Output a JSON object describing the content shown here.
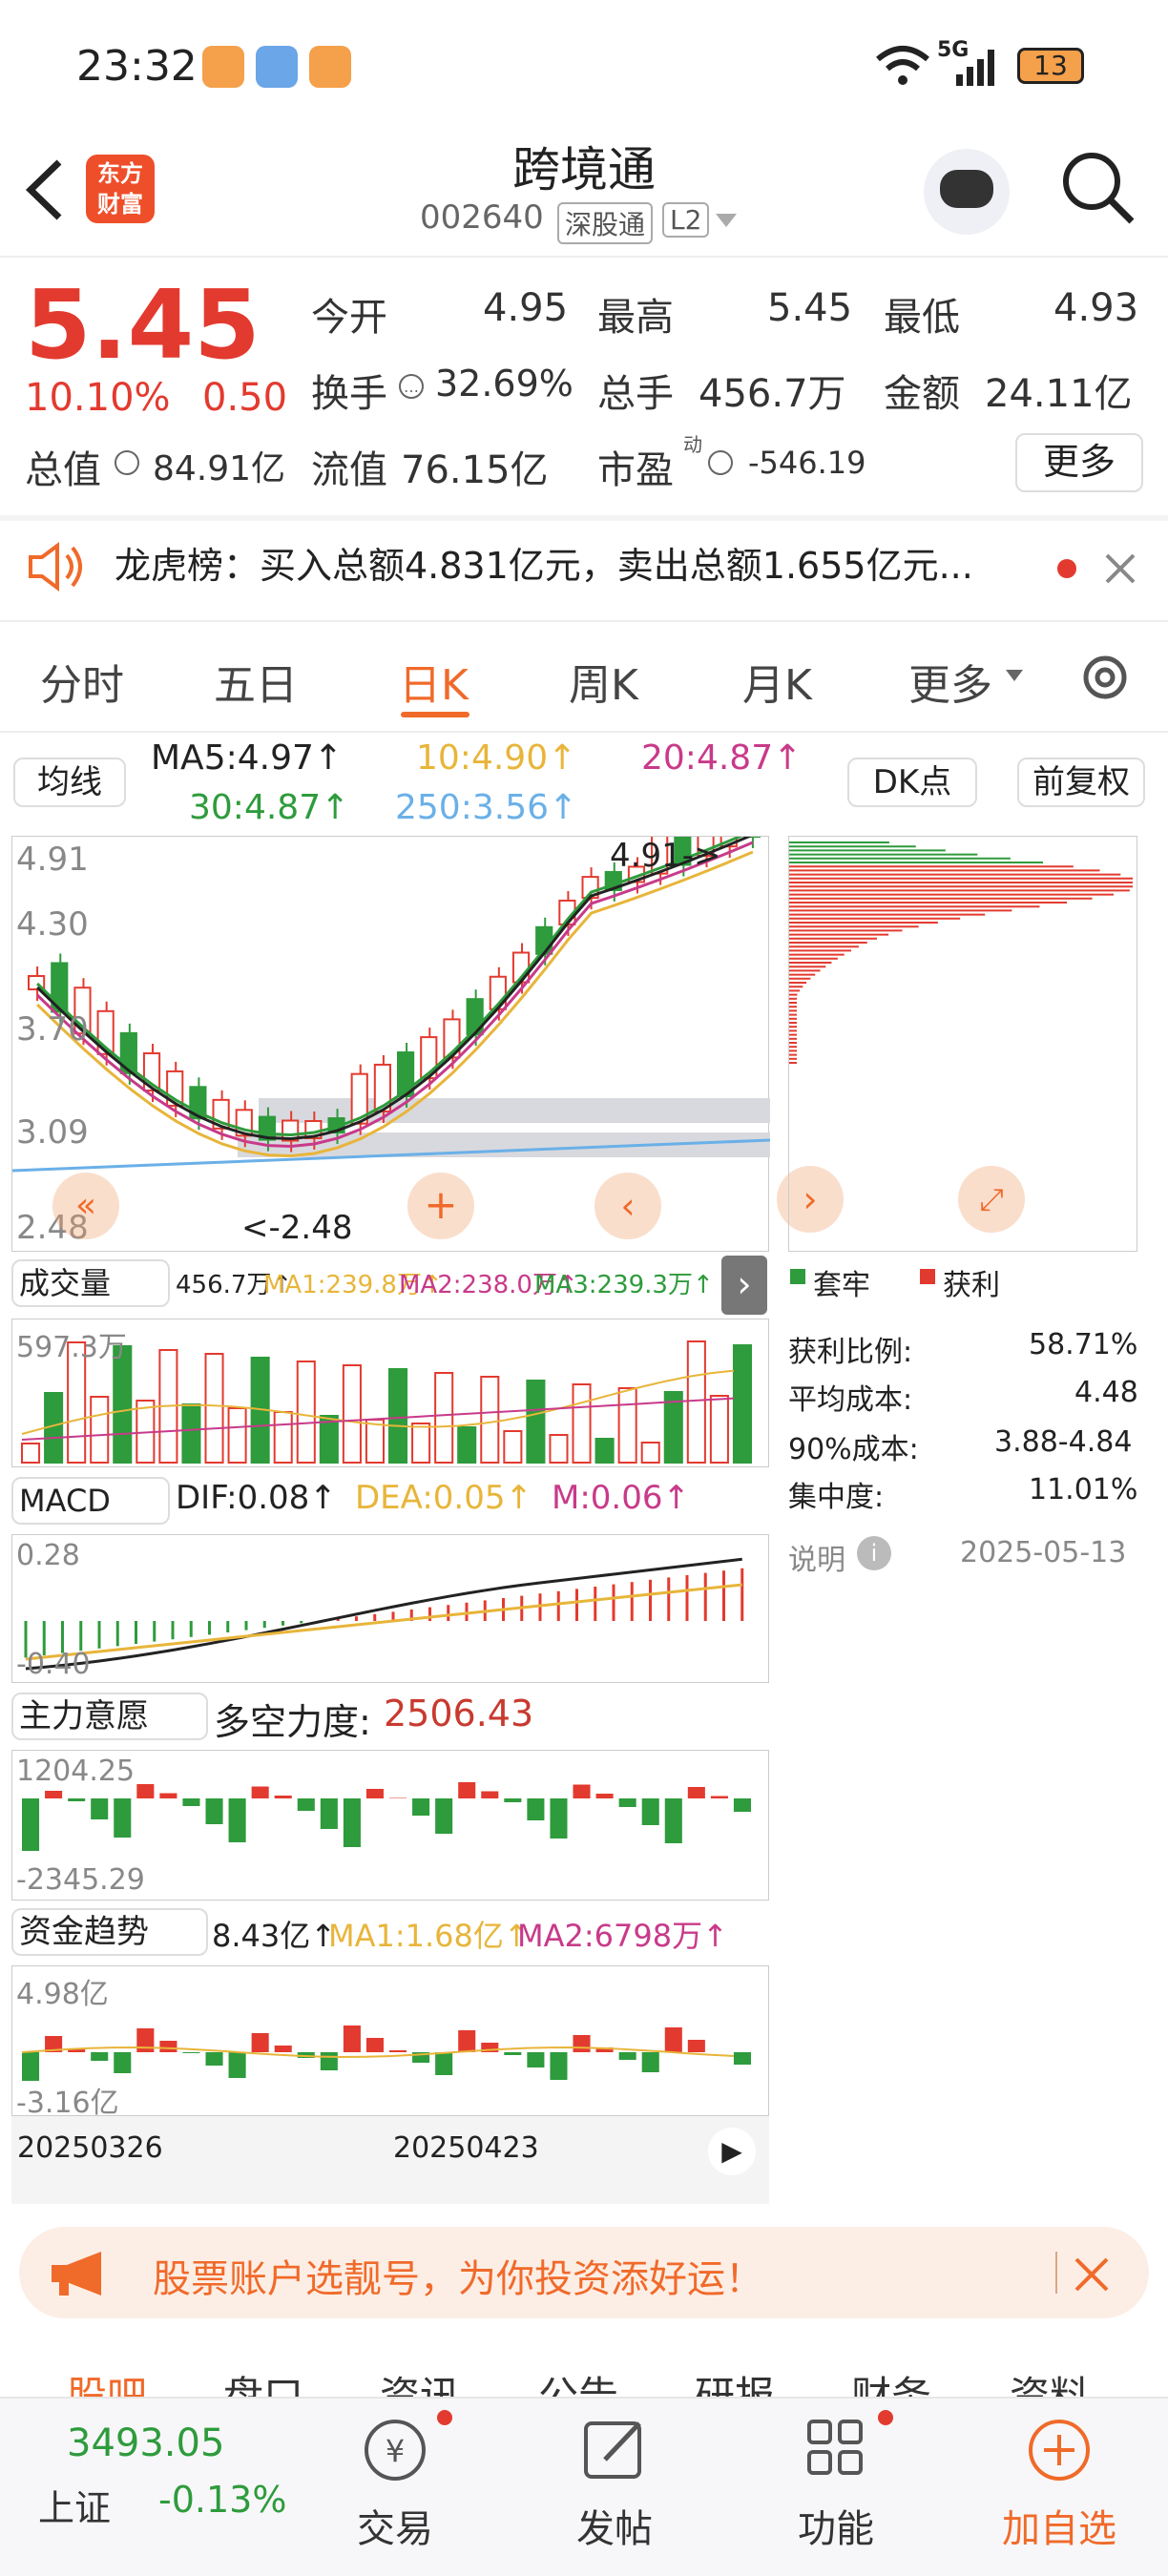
{
  "status": {
    "time": "23:32",
    "network": "5G",
    "battery": "13"
  },
  "header": {
    "title": "跨境通",
    "code": "002640",
    "tag1": "深股通",
    "tag2": "L2",
    "logo": "东方\n财富"
  },
  "quote": {
    "price": "5.45",
    "pct": "10.10%",
    "change": "0.50",
    "open_label": "今开",
    "open": "4.95",
    "high_label": "最高",
    "high": "5.45",
    "low_label": "最低",
    "low": "4.93",
    "turnover_label": "换手",
    "turnover": "32.69%",
    "volume_label": "总手",
    "volume": "456.7万",
    "amount_label": "金额",
    "amount": "24.11亿",
    "mcap_label": "总值",
    "mcap": "84.91亿",
    "float_label": "流值",
    "float": "76.15亿",
    "pe_label": "市盈",
    "pe_sup": "动",
    "pe": "-546.19",
    "more": "更多"
  },
  "notice": {
    "text": "龙虎榜：买入总额4.831亿元，卖出总额1.655亿元..."
  },
  "tabs": [
    "分时",
    "五日",
    "日K",
    "周K",
    "月K",
    "更多"
  ],
  "active_tab": "日K",
  "kline": {
    "ma_btn": "均线",
    "ma5": "MA5:4.97↑",
    "ma10": "10:4.90↑",
    "ma20": "20:4.87↑",
    "ma30": "30:4.87↑",
    "ma250": "250:3.56↑",
    "dk_btn": "DK点",
    "fq_btn": "前复权",
    "y_labels": [
      "4.91",
      "4.30",
      "3.70",
      "3.09",
      "2.48"
    ],
    "high_note": "4.91->",
    "low_note": "<-2.48"
  },
  "chip": {
    "legend_trap": "套牢",
    "legend_profit": "获利",
    "rows": [
      {
        "label": "获利比例:",
        "value": "58.71%"
      },
      {
        "label": "平均成本:",
        "value": "4.48"
      },
      {
        "label": "90%成本:",
        "value": "3.88-4.84"
      },
      {
        "label": "集中度:",
        "value": "11.01%"
      }
    ],
    "note": "说明",
    "date": "2025-05-13"
  },
  "volume": {
    "btn": "成交量",
    "v": "456.7万↑",
    "ma1": "MA1:239.8万↑",
    "ma2": "MA2:238.0万↑",
    "ma3": "MA3:239.3万↑",
    "ymax": "597.3万"
  },
  "macd": {
    "btn": "MACD",
    "dif": "DIF:0.08↑",
    "dea": "DEA:0.05↑",
    "m": "M:0.06↑",
    "ymax": "0.28",
    "ymin": "-0.40"
  },
  "force": {
    "btn": "主力意愿",
    "label": "多空力度:",
    "value": "2506.43",
    "ymax": "1204.25",
    "ymin": "-2345.29"
  },
  "fund": {
    "btn": "资金趋势",
    "v": "8.43亿↑",
    "ma1": "MA1:1.68亿↑",
    "ma2": "MA2:6798万↑",
    "ymax": "4.98亿",
    "ymin": "-3.16亿"
  },
  "dates": [
    "20250326",
    "20250423"
  ],
  "promo": {
    "text": "股票账户选靓号，为你投资添好运！"
  },
  "subtabs": [
    "股吧",
    "盘口",
    "资讯",
    "公告",
    "研报",
    "财务",
    "资料"
  ],
  "bottom": {
    "index_value": "3493.05",
    "index_name": "上证",
    "index_pct": "-0.13%",
    "items": [
      "交易",
      "发帖",
      "功能",
      "加自选"
    ]
  },
  "colors": {
    "up": "#e33a2f",
    "down": "#2e9b3c",
    "accent": "#f06a2a"
  }
}
